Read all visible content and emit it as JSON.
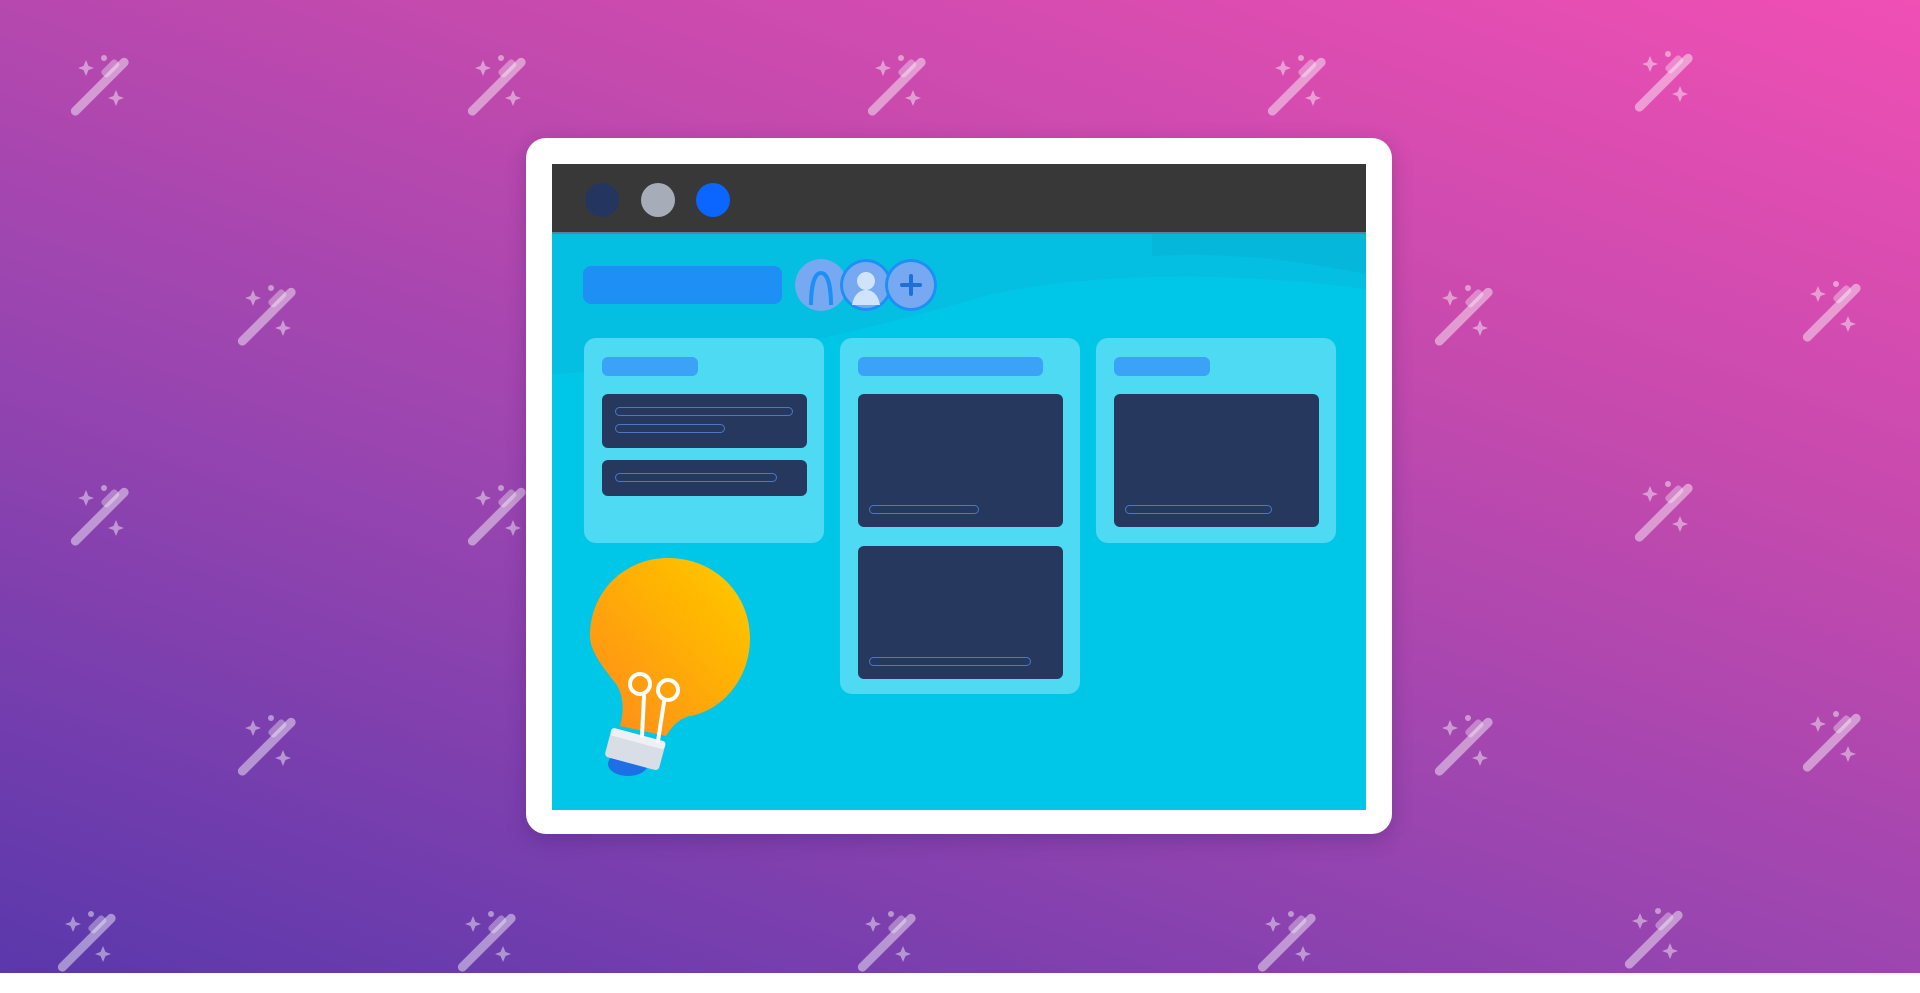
{
  "colors": {
    "background_top": "#f04fb4",
    "background_bottom": "#5a38ac",
    "window_frame": "#ffffff",
    "titlebar": "#383838",
    "content_bg": "#00c6e8",
    "column_bg": "#4ddaf2",
    "card_bg": "#26385e",
    "accent_blue": "#1e8ff5",
    "header_pill": "#3ba2f7",
    "avatar": "#76a9f2",
    "bulb_yellow": "#ffc200",
    "bulb_orange": "#ff8f1f"
  },
  "window": {
    "titlebar": {
      "dots": [
        {
          "color": "#24365f"
        },
        {
          "color": "#a7adb8"
        },
        {
          "color": "#0a66ff"
        }
      ]
    }
  },
  "board": {
    "members": [
      {
        "icon": "person-icon"
      },
      {
        "icon": "person-icon"
      },
      {
        "icon": "plus-icon"
      }
    ],
    "columns": [
      {
        "cards": 2
      },
      {
        "cards": 2
      },
      {
        "cards": 1
      }
    ]
  },
  "decorations": {
    "pattern_icon": "magic-wand-icon",
    "illustration_icon": "lightbulb-icon"
  }
}
